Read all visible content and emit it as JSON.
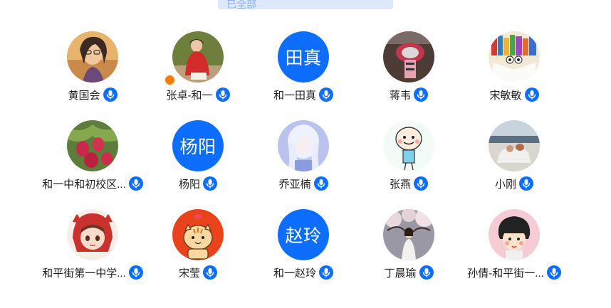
{
  "colors": {
    "accent": "#0d6efd",
    "tab_bg": "#dde9fb",
    "badge": "#ff7a00"
  },
  "top_tab": {
    "label": "已全部"
  },
  "members": [
    {
      "name": "黄国会",
      "avatar": "photo-woman-glasses",
      "host": false
    },
    {
      "name": "张卓-和一",
      "avatar": "photo-woman-red",
      "host": true
    },
    {
      "name": "和一田真",
      "avatar_text": "田真",
      "host": false
    },
    {
      "name": "蒋韦",
      "avatar": "photo-red-toy",
      "host": false
    },
    {
      "name": "宋敏敏",
      "avatar": "photo-books",
      "host": false
    },
    {
      "name": "和一中和初校区...",
      "avatar": "photo-dragonfruit",
      "host": false
    },
    {
      "name": "杨阳",
      "avatar_text": "杨阳",
      "host": false
    },
    {
      "name": "乔亚楠",
      "avatar": "illustration-white-hair",
      "host": false
    },
    {
      "name": "张燕",
      "avatar": "cartoon-smiley",
      "host": false
    },
    {
      "name": "小刚",
      "avatar": "photo-beach",
      "host": false
    },
    {
      "name": "和平街第一中学...",
      "avatar": "anime-red-hood",
      "host": false
    },
    {
      "name": "宋莹",
      "avatar": "cartoon-tiger",
      "host": false
    },
    {
      "name": "和一赵玲",
      "avatar_text": "赵玲",
      "host": false
    },
    {
      "name": "丁晨瑜",
      "avatar": "photo-cherry-blossom",
      "host": false
    },
    {
      "name": "孙倩-和平街一...",
      "avatar": "cartoon-maruko",
      "host": false
    }
  ]
}
